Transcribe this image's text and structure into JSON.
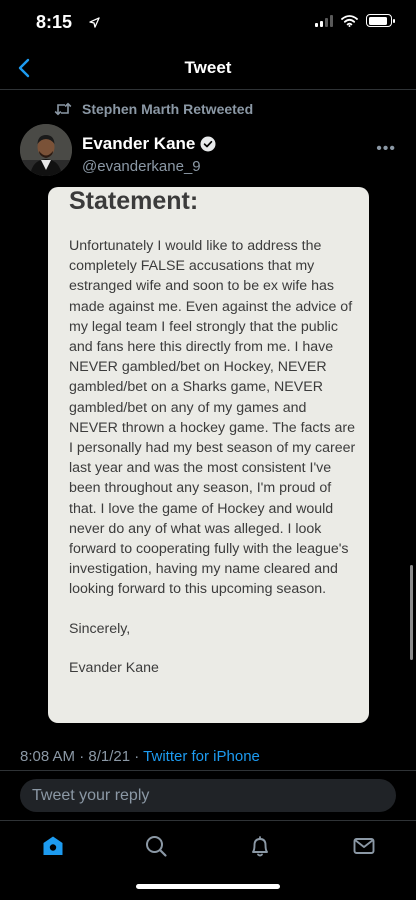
{
  "status": {
    "time": "8:15",
    "battery_level": 0.9
  },
  "header": {
    "title": "Tweet"
  },
  "retweet": {
    "text": "Stephen Marth Retweeted"
  },
  "author": {
    "name": "Evander Kane",
    "handle": "@evanderkane_9",
    "verified": true
  },
  "statement": {
    "title": "Statement:",
    "paragraphs": [
      "Unfortunately I would like to address the completely FALSE accusations that my estranged wife and soon to be ex wife has made against me. Even against the advice of my legal team I feel strongly that the public and fans here this directly from me. I have NEVER gambled/bet on Hockey, NEVER gambled/bet on a Sharks game, NEVER gambled/bet on any of my games and NEVER thrown a hockey game. The facts are I personally had my best season of my career last year and was the most consistent I've been throughout any season, I'm proud of that. I love the game of Hockey and would never do any of what was alleged. I look forward to cooperating fully with the league's investigation, having my name cleared and looking forward to this upcoming season.",
      "Sincerely,",
      "Evander Kane"
    ]
  },
  "meta": {
    "time": "8:08 AM",
    "sep1": " · ",
    "date": "8/1/21",
    "sep2": " · ",
    "source": "Twitter for iPhone"
  },
  "reply": {
    "placeholder": "Tweet your reply"
  },
  "colors": {
    "accent": "#1d9bf0",
    "background": "#000000",
    "card": "#ebebe6"
  }
}
